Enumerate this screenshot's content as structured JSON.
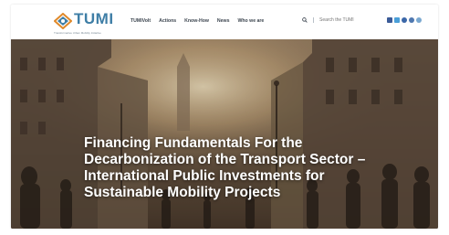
{
  "logo": {
    "name": "TUMI",
    "tagline": "Transformative Urban Mobility Initiative"
  },
  "nav": {
    "items": [
      {
        "label": "TUMIVolt"
      },
      {
        "label": "Actions"
      },
      {
        "label": "Know-How"
      },
      {
        "label": "News"
      },
      {
        "label": "Who we are"
      }
    ]
  },
  "search": {
    "placeholder": "Search the TUMI"
  },
  "social": {
    "icons": [
      "facebook-icon",
      "twitter-icon",
      "youtube-icon",
      "pinterest-icon",
      "instagram-icon"
    ]
  },
  "hero": {
    "title_lines": [
      "Financing Fundamentals For the",
      "Decarbonization of the Transport Sector –",
      "International Public Investments for",
      "Sustainable Mobility Projects"
    ]
  },
  "colors": {
    "brand": "#3e7ea6",
    "header_bg": "#ffffff",
    "title_text": "#ffffff"
  }
}
